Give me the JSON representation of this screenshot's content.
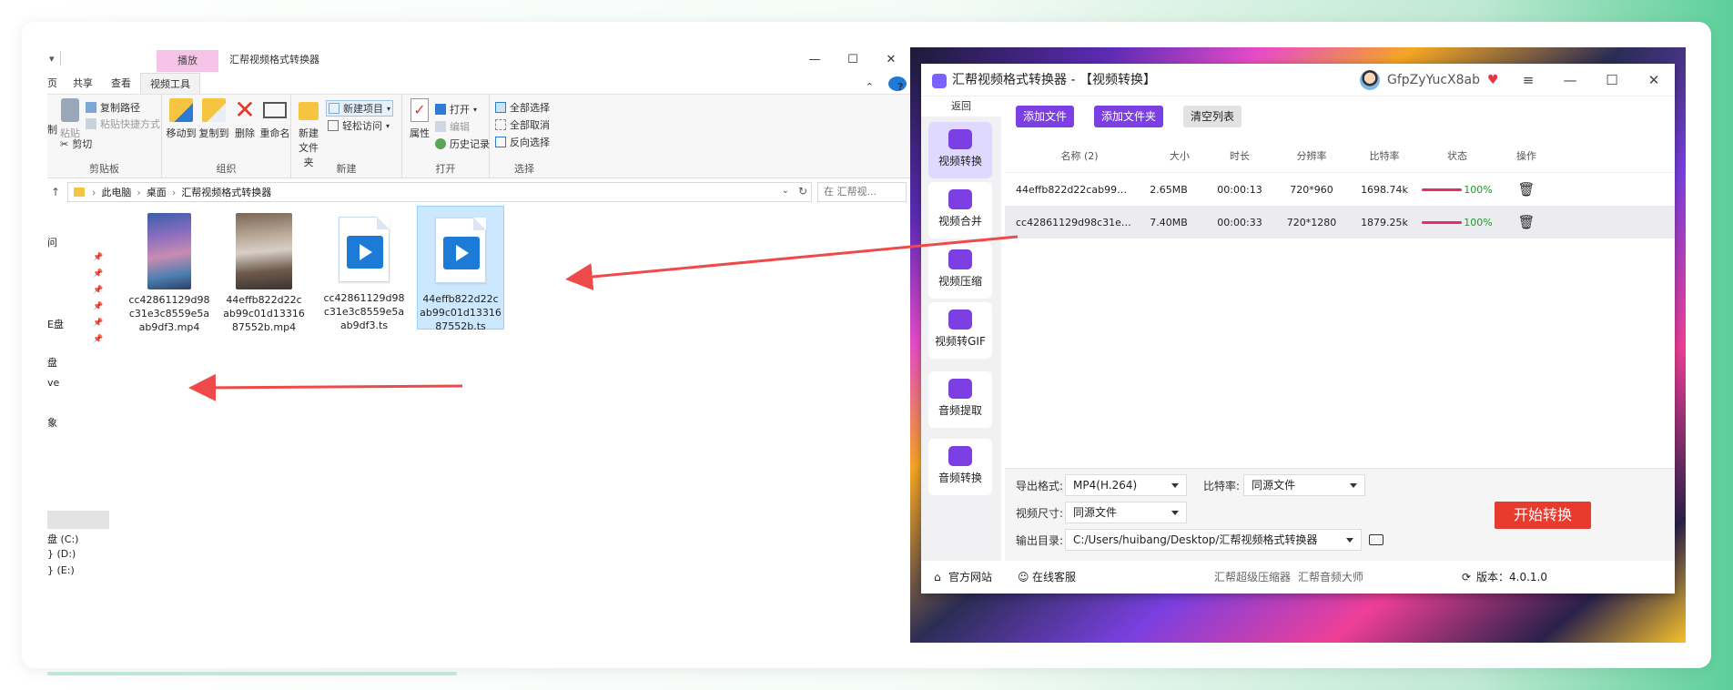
{
  "explorer": {
    "ribbon_context_tab": "播放",
    "window_title": "汇帮视频格式转换器",
    "window_controls": [
      "—",
      "☐",
      "✕"
    ],
    "tabs": [
      "页",
      "共享",
      "查看",
      "视频工具"
    ],
    "clipboard": {
      "paste": "粘贴",
      "copy_path": "复制路径",
      "paste_shortcut": "粘贴快捷方式",
      "cut": "剪切",
      "label": "剪贴板",
      "left_partial": "制"
    },
    "organize": {
      "move_to": "移动到",
      "copy_to": "复制到",
      "delete": "删除",
      "rename": "重命名",
      "label": "组织"
    },
    "new_group": {
      "new_item": "新建项目",
      "easy_access": "轻松访问",
      "new_folder_line1": "新建",
      "new_folder_line2": "文件夹",
      "label": "新建"
    },
    "open_group": {
      "properties": "属性",
      "open": "打开",
      "edit": "编辑",
      "history": "历史记录",
      "label": "打开"
    },
    "select_group": {
      "select_all": "全部选择",
      "select_none": "全部取消",
      "invert": "反向选择",
      "label": "选择"
    },
    "address": {
      "segments": [
        "此电脑",
        "桌面",
        "汇帮视频格式转换器"
      ],
      "search_placeholder": "在 汇帮视..."
    },
    "nav": {
      "item1": "问",
      "item2": "E盘",
      "item3": "盘",
      "item4": "ve",
      "item5": "象",
      "drive_c": "盘 (C:)",
      "drive_d": "} (D:)",
      "drive_e": "} (E:)"
    },
    "files": [
      {
        "name": "cc42861129d98c31e3c8559e5aab9df3.mp4",
        "line1": "cc42861129d98",
        "line2": "c31e3c8559e5a",
        "line3": "ab9df3.mp4"
      },
      {
        "name": "44effb822d22cab99c01d1331687552b.mp4",
        "line1": "44effb822d22c",
        "line2": "ab99c01d13316",
        "line3": "87552b.mp4"
      },
      {
        "name": "cc42861129d98c31e3c8559e5aab9df3.ts",
        "line1": "cc42861129d98",
        "line2": "c31e3c8559e5a",
        "line3": "ab9df3.ts"
      },
      {
        "name": "44effb822d22cab99c01d1331687552b.ts",
        "line1": "44effb822d22c",
        "line2": "ab99c01d13316",
        "line3": "87552b.ts"
      }
    ]
  },
  "converter": {
    "title": "汇帮视频格式转换器 - 【视频转换】",
    "username": "GfpZyYucX8ab",
    "vip_icon": "♥",
    "window_controls": [
      "≡",
      "—",
      "☐",
      "✕"
    ],
    "back": "返回",
    "sidebar": [
      {
        "label": "视频转换",
        "icon": "video-convert-icon",
        "active": true
      },
      {
        "label": "视频合并",
        "icon": "video-merge-icon"
      },
      {
        "label": "视频压缩",
        "icon": "video-compress-icon"
      },
      {
        "label": "视频转GIF",
        "icon": "gif-icon"
      },
      {
        "label": "音频提取",
        "icon": "music-note-icon"
      },
      {
        "label": "音频转换",
        "icon": "microphone-icon"
      }
    ],
    "toolbar": {
      "add_file": "添加文件",
      "add_folder": "添加文件夹",
      "clear_list": "清空列表"
    },
    "columns": [
      "名称 (2)",
      "大小",
      "时长",
      "分辨率",
      "比特率",
      "状态",
      "操作"
    ],
    "rows": [
      {
        "name": "44effb822d22cab99c01d...",
        "size": "2.65MB",
        "duration": "00:00:13",
        "resolution": "720*960",
        "bitrate": "1698.74k",
        "status": "100%",
        "progress": 1.0
      },
      {
        "name": "cc42861129d98c31e3c85...",
        "size": "7.40MB",
        "duration": "00:00:33",
        "resolution": "720*1280",
        "bitrate": "1879.25k",
        "status": "100%",
        "progress": 1.0
      }
    ],
    "settings": {
      "format_label": "导出格式:",
      "format_value": "MP4(H.264)",
      "bitrate_label": "比特率:",
      "bitrate_value": "同源文件",
      "size_label": "视频尺寸:",
      "size_value": "同源文件",
      "output_label": "输出目录:",
      "output_value": "C:/Users/huibang/Desktop/汇帮视频格式转换器",
      "start_button": "开始转换"
    },
    "footer": {
      "website": "官方网站",
      "support": "在线客服",
      "compressor": "汇帮超级压缩器",
      "audio_master": "汇帮音频大师",
      "version": "版本：4.0.1.0"
    },
    "colors": {
      "accent": "#7b3fe4",
      "start": "#e93a2e",
      "progress": "#e72d62",
      "status": "#1b9a2c",
      "arrow": "#ef4a4a"
    }
  }
}
